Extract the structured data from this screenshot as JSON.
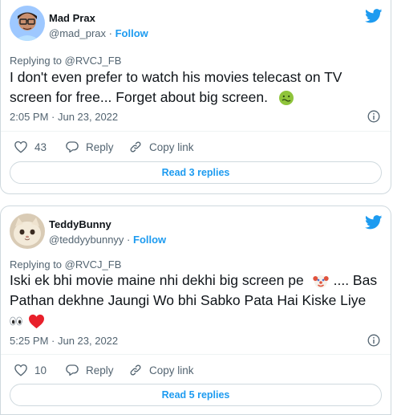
{
  "colors": {
    "accent": "#1d9bf0",
    "muted": "#536471",
    "text": "#0f1419",
    "border": "#cfd9de",
    "heart": "#f4212e"
  },
  "tweets": [
    {
      "author_name": "Mad Prax",
      "author_handle": "@mad_prax",
      "separator": "·",
      "follow_label": "Follow",
      "replying_to": "Replying to @RVCJ_FB",
      "text_line1": "I don't even prefer to watch his movies telecast on TV",
      "text_line2": "screen for free... Forget about big screen.",
      "trailing_emoji": "nauseated-face-emoji",
      "timestamp": "2:05 PM · Jun 23, 2022",
      "like_count": "43",
      "reply_label": "Reply",
      "copy_link_label": "Copy link",
      "read_replies_label": "Read 3 replies"
    },
    {
      "author_name": "TeddyBunny",
      "author_handle": "@teddyybunnyy",
      "separator": "·",
      "follow_label": "Follow",
      "replying_to": "Replying to @RVCJ_FB",
      "text_line1a": "Iski ek bhi movie maine nhi dekhi big screen pe",
      "text_line1b": ".... Bas",
      "text_line2": "Pathan dekhne Jaungi Wo bhi Sabko Pata Hai Kiske Liye",
      "inline_emojis": [
        "clown-face-emoji",
        "eyes-emoji",
        "red-heart-emoji"
      ],
      "timestamp": "5:25 PM · Jun 23, 2022",
      "like_count": "10",
      "reply_label": "Reply",
      "copy_link_label": "Copy link",
      "read_replies_label": "Read 5 replies"
    }
  ]
}
